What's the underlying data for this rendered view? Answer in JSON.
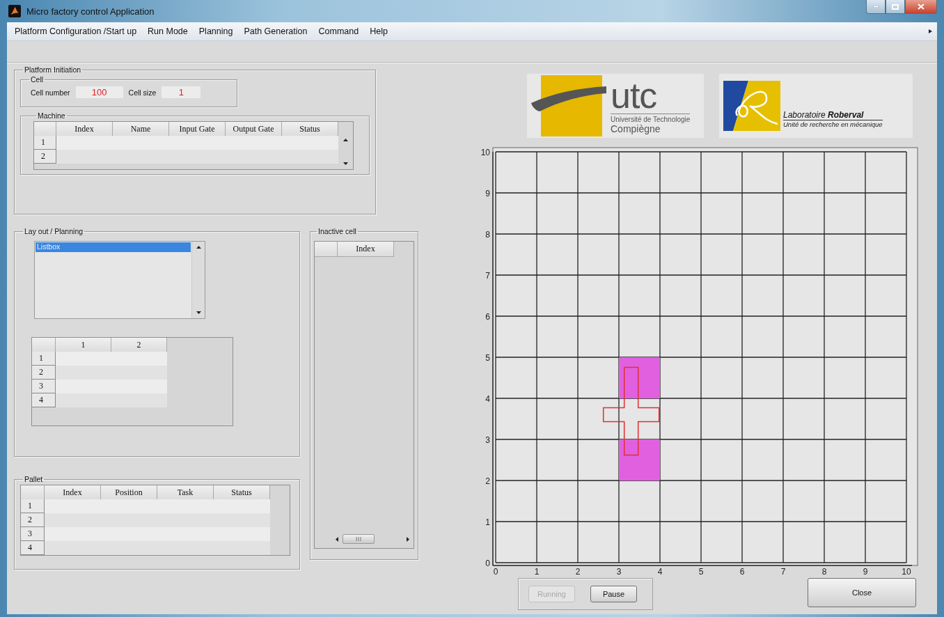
{
  "window": {
    "title": "Micro factory control Application"
  },
  "menu": [
    {
      "label": "Platform Configuration /Start up"
    },
    {
      "label": "Run Mode"
    },
    {
      "label": "Planning"
    },
    {
      "label": "Path Generation"
    },
    {
      "label": "Command"
    },
    {
      "label": "Help"
    }
  ],
  "platform_initiation": {
    "title": "Platform Initiation",
    "cell": {
      "title": "Cell",
      "fields": [
        {
          "label": "Cell number",
          "value": "100"
        },
        {
          "label": "Cell size",
          "value": "1"
        }
      ]
    },
    "machine": {
      "title": "Machine",
      "columns": [
        "Index",
        "Name",
        "Input Gate",
        "Output Gate",
        "Status"
      ],
      "rows": [
        "1",
        "2"
      ]
    }
  },
  "layout_planning": {
    "title": "Lay out / Planning",
    "listbox": {
      "items": [
        {
          "label": "Listbox",
          "selected": true
        }
      ]
    },
    "table": {
      "columns": [
        "1",
        "2"
      ],
      "rows": [
        "1",
        "2",
        "3",
        "4"
      ]
    }
  },
  "pallet": {
    "title": "Pallet",
    "columns": [
      "Index",
      "Position",
      "Task",
      "Status"
    ],
    "rows": [
      "1",
      "2",
      "3",
      "4"
    ]
  },
  "inactive_cell": {
    "title": "Inactive cell",
    "columns": [
      "Index"
    ]
  },
  "logos": {
    "utc": {
      "mark": "utc",
      "line1": "Université de Technologie",
      "line2": "Compiègne"
    },
    "lab": {
      "name": "Laboratoire **Roberval**",
      "subtitle": "Unité de recherche en mécanique"
    }
  },
  "plot": {
    "chart_data": {
      "type": "scatter",
      "xlim": [
        0,
        10
      ],
      "ylim": [
        0,
        10
      ],
      "xticks": [
        0,
        1,
        2,
        3,
        4,
        5,
        6,
        7,
        8,
        9,
        10
      ],
      "yticks": [
        0,
        1,
        2,
        3,
        4,
        5,
        6,
        7,
        8,
        9,
        10
      ],
      "grid": true
    }
  },
  "run_controls": [
    {
      "label": "Running",
      "disabled": true
    },
    {
      "label": "Pause",
      "disabled": false
    }
  ],
  "close_button": {
    "label": "Close"
  }
}
